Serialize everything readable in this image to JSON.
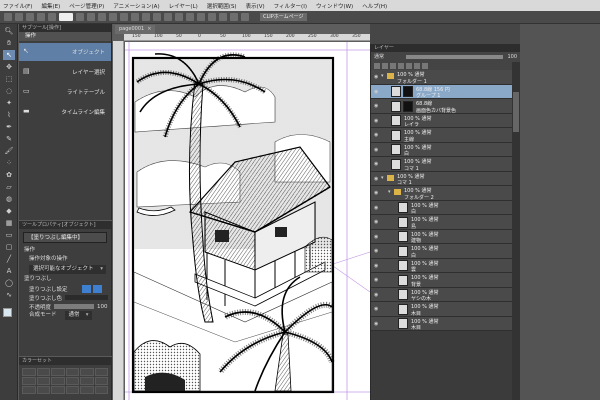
{
  "menu": [
    "ファイル(F)",
    "編集(E)",
    "ページ管理(P)",
    "アニメーション(A)",
    "レイヤー(L)",
    "選択範囲(S)",
    "表示(V)",
    "フィルター(I)",
    "ウィンドウ(W)",
    "ヘルプ(H)"
  ],
  "command_bar": {
    "clip_label": "CLIPホームページ"
  },
  "sub_tool": {
    "panel_title": "サブツール[操作]",
    "tab": "操作",
    "items": [
      {
        "icon": "arrow-cursor-icon",
        "glyph": "↖",
        "label": "オブジェクト"
      },
      {
        "icon": "layers-icon",
        "glyph": "▤",
        "label": "レイヤー選択"
      },
      {
        "icon": "light-table-icon",
        "glyph": "▭",
        "label": "ライトテーブル"
      },
      {
        "icon": "timeline-icon",
        "glyph": "▬",
        "label": "タイムライン編集"
      }
    ]
  },
  "tool_property": {
    "panel_title": "ツールプロパティ[オブジェクト]",
    "header": "【塗りつぶし編集中】",
    "section": "操作",
    "target_label": "操作対象の操作",
    "target_value": "選択可能なオブジェクト",
    "fill_label": "塗りつぶし",
    "fill_setting": "塗りつぶし設定",
    "fill_opacity_label": "塗りつぶし色",
    "opacity_label": "不透明度",
    "opacity_value": "100",
    "opacity_fraction": 1.0,
    "blend_label": "合成モード",
    "blend_value": "通常"
  },
  "color_panel": {
    "title": "カラーセット"
  },
  "document": {
    "tab": "page0001"
  },
  "rulers": [
    "150",
    "100",
    "50",
    "0",
    "50",
    "100",
    "150",
    "200",
    "250",
    "300",
    "350"
  ],
  "layer_panel": {
    "title": "レイヤー",
    "blend_mode": "通常",
    "opacity_value": "100",
    "opacity_fraction": 1.0,
    "layers": [
      {
        "type": "folder",
        "indent": 0,
        "line1": "100 % 通常",
        "line2": "フォルダー 1",
        "selected": false
      },
      {
        "type": "mask",
        "indent": 1,
        "line1": "68.8線 156 円",
        "line2": "グループ 1",
        "selected": true
      },
      {
        "type": "mask",
        "indent": 1,
        "line1": "68.8線",
        "line2": "画面色カバ背景色",
        "selected": false
      },
      {
        "type": "layer",
        "indent": 1,
        "line1": "100 % 通常",
        "line2": "レイラ",
        "selected": false
      },
      {
        "type": "layer",
        "indent": 1,
        "line1": "100 % 通常",
        "line2": "主線",
        "selected": false
      },
      {
        "type": "layer",
        "indent": 1,
        "line1": "100 % 通常",
        "line2": "白",
        "selected": false
      },
      {
        "type": "layer",
        "indent": 1,
        "line1": "100 % 通常",
        "line2": "コマ 1",
        "selected": false
      },
      {
        "type": "folder",
        "indent": 0,
        "line1": "100 % 通常",
        "line2": "コマ 1",
        "selected": false
      },
      {
        "type": "folder",
        "indent": 1,
        "line1": "100 % 通常",
        "line2": "フォルダー 2",
        "selected": false
      },
      {
        "type": "layer",
        "indent": 2,
        "line1": "100 % 通常",
        "line2": "白",
        "selected": false
      },
      {
        "type": "layer",
        "indent": 2,
        "line1": "100 % 通常",
        "line2": "島",
        "selected": false
      },
      {
        "type": "layer",
        "indent": 2,
        "line1": "100 % 通常",
        "line2": "建物",
        "selected": false
      },
      {
        "type": "layer",
        "indent": 2,
        "line1": "100 % 通常",
        "line2": "白",
        "selected": false
      },
      {
        "type": "layer",
        "indent": 2,
        "line1": "100 % 通常",
        "line2": "雲",
        "selected": false
      },
      {
        "type": "layer",
        "indent": 2,
        "line1": "100 % 通常",
        "line2": "背景",
        "selected": false
      },
      {
        "type": "layer",
        "indent": 2,
        "line1": "100 % 通常",
        "line2": "ヤシの木",
        "selected": false
      },
      {
        "type": "layer",
        "indent": 2,
        "line1": "100 % 通常",
        "line2": "木目",
        "selected": false
      },
      {
        "type": "layer",
        "indent": 2,
        "line1": "100 % 通常",
        "line2": "木目",
        "selected": false
      }
    ]
  },
  "colors": {
    "selection": "#8aa9c9",
    "accent": "#5f7fa6",
    "panel": "#3e3e3e",
    "folder": "#d9b24a"
  }
}
